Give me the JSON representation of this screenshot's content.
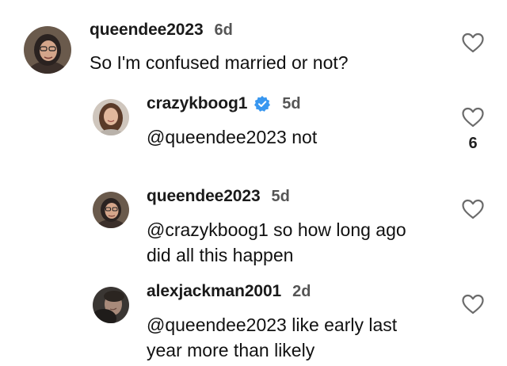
{
  "comments": [
    {
      "username": "queendee2023",
      "time": "6d",
      "text": "So I'm confused married or not?",
      "verified": false,
      "like_icon": "heart-outline-icon"
    },
    {
      "username": "crazykboog1",
      "time": "5d",
      "text": "@queendee2023 not",
      "verified": true,
      "like_icon": "heart-outline-icon",
      "like_count": "6"
    },
    {
      "username": "queendee2023",
      "time": "5d",
      "text_line1": "@crazykboog1 so how long ago",
      "text_line2": "did all this happen",
      "verified": false,
      "like_icon": "heart-outline-icon"
    },
    {
      "username": "alexjackman2001",
      "time": "2d",
      "text_line1": "@queendee2023 like early last",
      "text_line2": "year more than likely",
      "verified": false,
      "like_icon": "heart-outline-icon"
    }
  ],
  "colors": {
    "verified_badge": "#3897f0",
    "text": "#111111",
    "timestamp": "#555555",
    "heart_stroke": "#6b6b6b"
  }
}
